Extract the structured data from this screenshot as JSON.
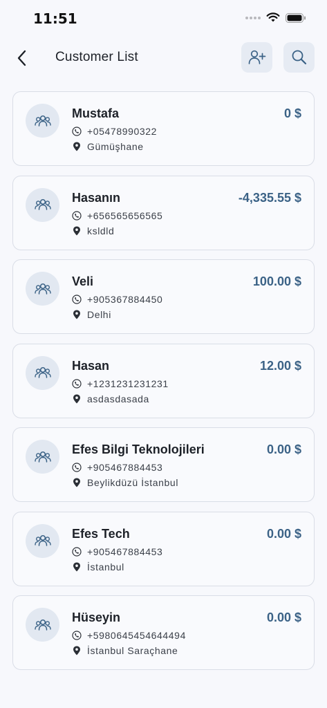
{
  "status_bar": {
    "time": "11:51"
  },
  "header": {
    "title": "Customer List"
  },
  "customers": [
    {
      "name": "Mustafa",
      "phone": "+05478990322",
      "address": "Gümüşhane",
      "balance": "0 $"
    },
    {
      "name": "Hasanın",
      "phone": "+656565656565",
      "address": "ksldld",
      "balance": "-4,335.55 $"
    },
    {
      "name": "Veli",
      "phone": "+905367884450",
      "address": "Delhi",
      "balance": "100.00 $"
    },
    {
      "name": "Hasan",
      "phone": "+1231231231231",
      "address": "asdasdasada",
      "balance": "12.00 $"
    },
    {
      "name": "Efes Bilgi Teknolojileri",
      "phone": "+905467884453",
      "address": "Beylikdüzü İstanbul",
      "balance": "0.00 $"
    },
    {
      "name": "Efes Tech",
      "phone": "+905467884453",
      "address": "İstanbul",
      "balance": "0.00 $"
    },
    {
      "name": "Hüseyin",
      "phone": "+5980645454644494",
      "address": "İstanbul Saraçhane",
      "balance": "0.00 $"
    }
  ],
  "icons": {
    "back": "chevron-left-icon",
    "add_user": "add-user-icon",
    "search": "search-icon",
    "avatar": "users-group-icon",
    "phone": "phone-icon",
    "location": "location-pin-icon"
  },
  "colors": {
    "accent": "#3b6286",
    "background": "#f7f8fc",
    "button_bg": "#e6ebf3"
  }
}
